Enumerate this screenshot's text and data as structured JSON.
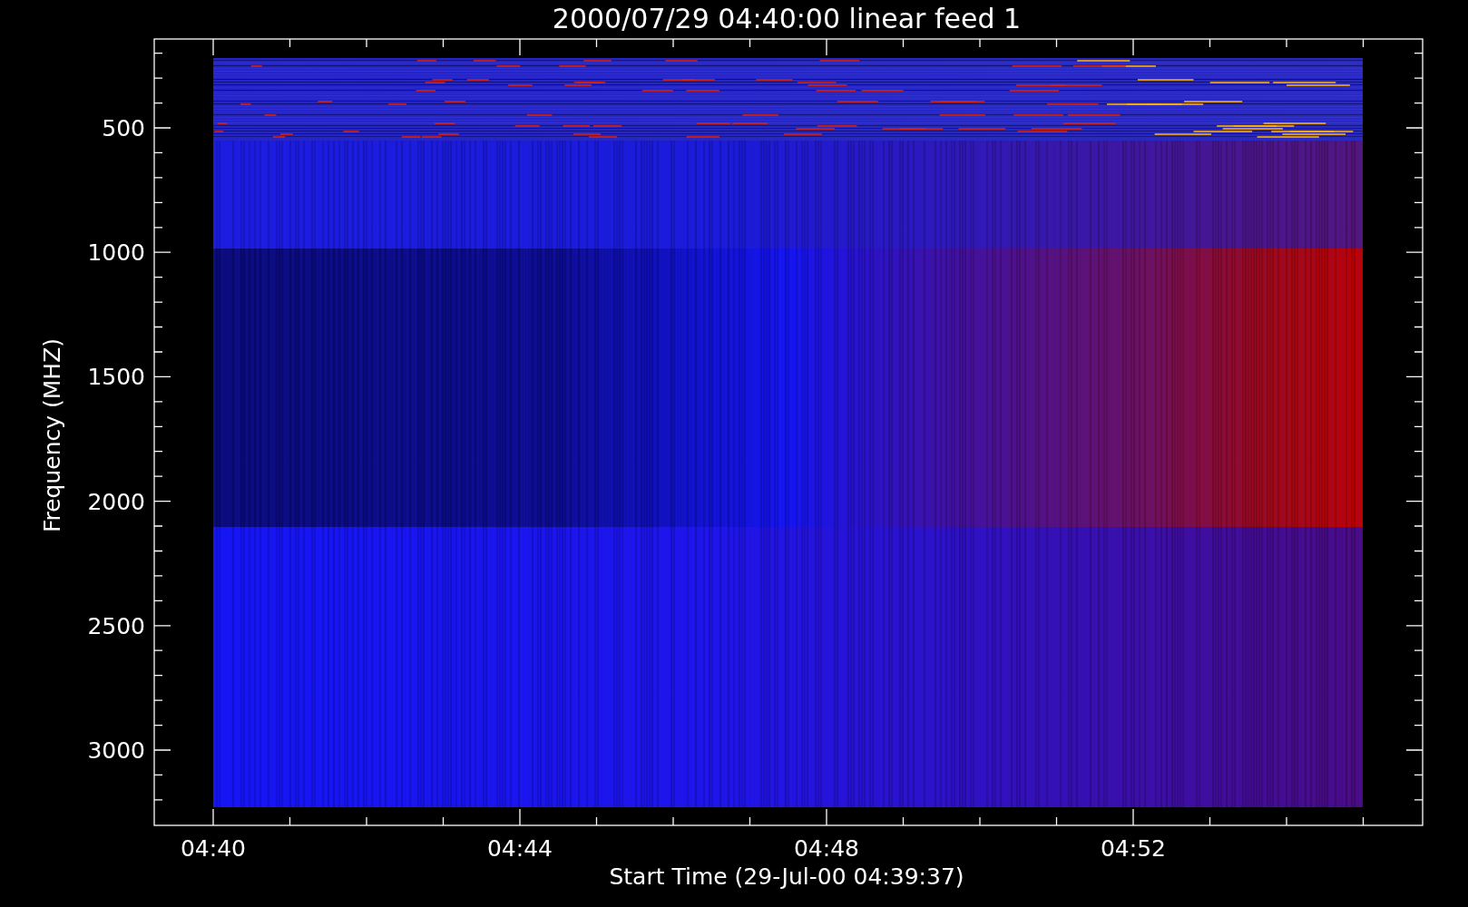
{
  "title": "2000/07/29 04:40:00 linear feed 1",
  "y_axis": {
    "label": "Frequency (MHZ)",
    "ticks": [
      "500",
      "1000",
      "1500",
      "2000",
      "2500",
      "3000"
    ]
  },
  "x_axis": {
    "label": "Start Time (29-Jul-00 04:39:37)",
    "ticks": [
      "04:40",
      "04:44",
      "04:48",
      "04:52"
    ]
  }
}
